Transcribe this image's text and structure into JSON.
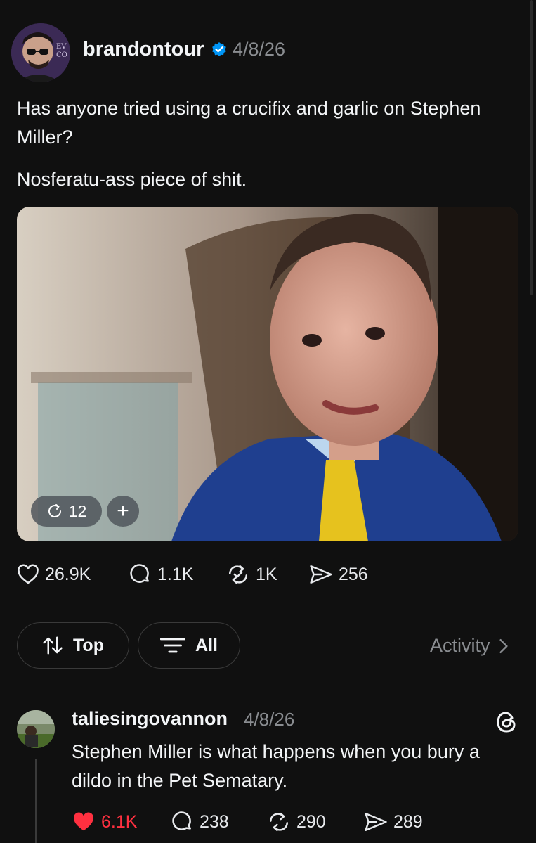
{
  "post": {
    "username": "brandontour",
    "timestamp": "4/8/26",
    "text_line1": "Has anyone tried using a crucifix and garlic on Stephen Miller?",
    "text_line2": "Nosferatu-ass piece of shit.",
    "media": {
      "repost_count": "12",
      "plus": "+"
    },
    "actions": {
      "likes": "26.9K",
      "replies": "1.1K",
      "reposts": "1K",
      "shares": "256"
    }
  },
  "filters": {
    "sort_label": "Top",
    "filter_label": "All",
    "activity_label": "Activity"
  },
  "reply": {
    "username": "taliesingovannon",
    "timestamp": "4/8/26",
    "text": "Stephen Miller is what happens when you bury a dildo in the Pet Sematary.",
    "actions": {
      "likes": "6.1K",
      "replies": "238",
      "reposts": "290",
      "shares": "289"
    }
  },
  "colors": {
    "background": "#101010",
    "text": "#f3f5f7",
    "muted": "#8a8d91",
    "verified": "#0095f6",
    "liked": "#ff3040"
  },
  "icons": [
    "verified-badge-icon",
    "repost-icon",
    "plus-icon",
    "heart-icon",
    "comment-icon",
    "share-icon",
    "sort-icon",
    "filter-icon",
    "chevron-right-icon",
    "threads-logo-icon"
  ]
}
